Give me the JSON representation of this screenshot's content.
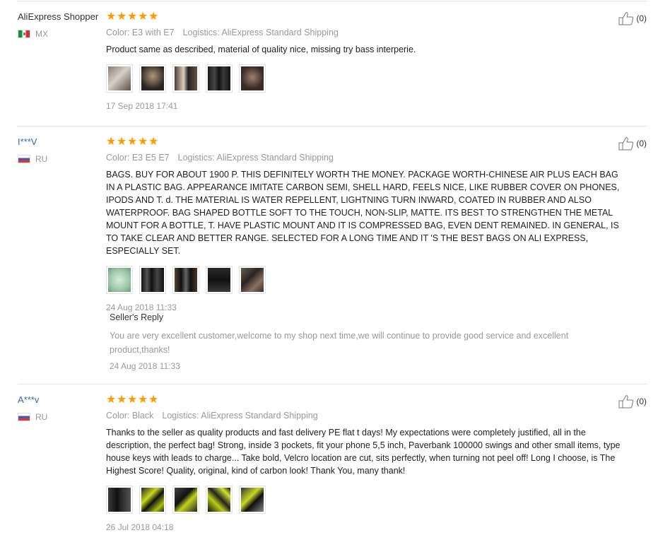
{
  "reviews": [
    {
      "user": "AliExpress Shopper",
      "country": "MX",
      "color": "Color: E3 with E7",
      "logistics": "Logistics: AliExpress Standard Shipping",
      "text": "Product same as described, material of quality nice, missing try bass interperie.",
      "date": "17 Sep 2018 17:41",
      "likes": "(0)",
      "rating_stars": 5
    },
    {
      "user": "I***V",
      "country": "RU",
      "color": "Color: E3 E5 E7",
      "logistics": "Logistics: AliExpress Standard Shipping",
      "text": "BAGS. BUY FOR ABOUT 1900 P. THIS DEFINITELY WORTH THE MONEY. PACKAGE WORTH-CHINESE AIR PLUS EACH BAG IN A PLASTIC BAG. APPEARANCE IMITATE CARBON SEMI, SHELL HARD, FEELS NICE, LIKE RUBBER COVER ON PHONES, IPODS AND T. d. THE MATERIAL IS WATER REPELLENT, LIGHTNING TURN INWARD, COATED IN RUBBER AND ALSO WATERPROOF. BAG SHAPED BOTTLE SOFT TO THE TOUCH, NON-SLIP, MATTE. ITS BEST TO STRENGTHEN THE METAL MOUNT FOR A BOTTLE, T. HAVE PLASTIC MOUNT AND IT IS COMPRESSED BAG, EVEN DENT REMAINED. IN GENERAL, IS TO TAKE CLEAR AND BETTER RANGE. SELECTED FOR A LONG TIME AND IT 'S THE BEST BAGS ON ALI EXPRESS, ESPECIALLY SET.",
      "date": "24 Aug 2018 11:33",
      "likes": "(0)",
      "rating_stars": 5,
      "reply": {
        "title": "Seller's Reply",
        "text": "You are very excellent customer,welcome to my shop next time,we will continue to provide good service and excellent product,thanks!",
        "date": "24 Aug 2018 11:33"
      }
    },
    {
      "user": "A***v",
      "country": "RU",
      "color": "Color: Black",
      "logistics": "Logistics: AliExpress Standard Shipping",
      "text": "Thanks to the seller as quality products and fast delivery PE flat t days! My expectations were completely justified, all in the description, the perfect bag! Strong, inside 3 pockets, fit your phone 5,5 inch, Paverbank 100000 swings and other small items, type house keys with leads to charge... Take bold, Velcro location are cut, sits perfectly, when turning not peel off! Long I choose, is The Highest Score! Quality, original, kind of carbon look! Thank You, many thank!",
      "date": "26 Jul 2018 04:18",
      "likes": "(0)",
      "rating_stars": 5
    }
  ],
  "icons": {
    "star": "star-icon",
    "like": "thumbs-up-icon"
  },
  "colors": {
    "star": "#ff9a00",
    "link": "#2b6fb6",
    "muted": "#999999"
  }
}
